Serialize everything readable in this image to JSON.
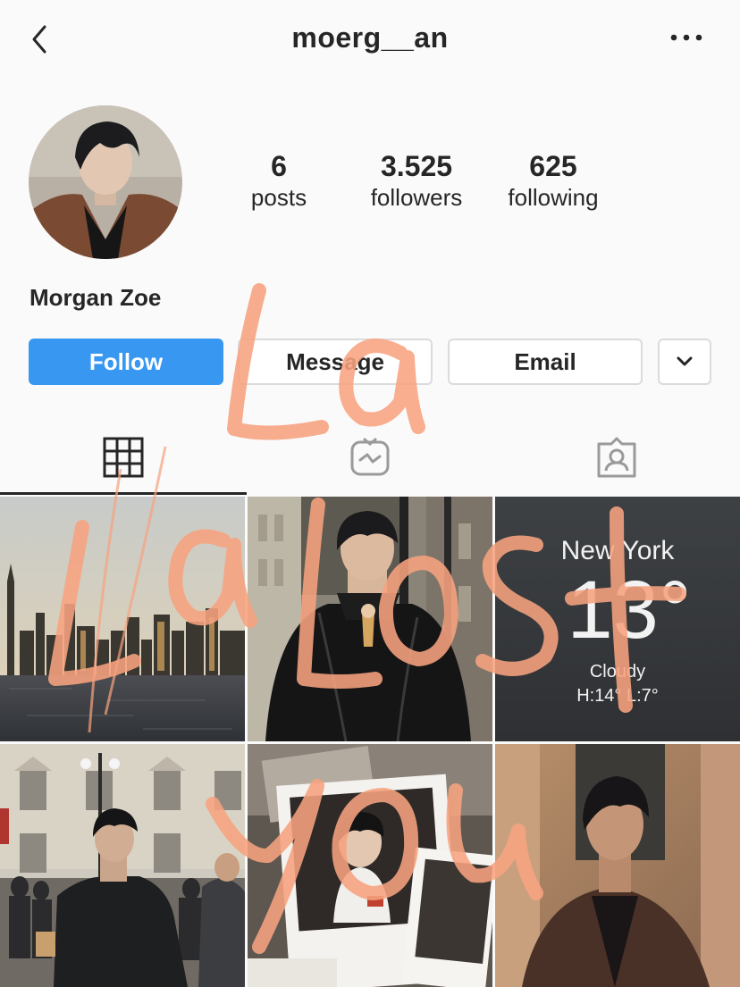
{
  "header": {
    "username": "moerg__an"
  },
  "profile": {
    "full_name": "Morgan Zoe",
    "stats": [
      {
        "value": "6",
        "label": "posts"
      },
      {
        "value": "3.525",
        "label": "followers"
      },
      {
        "value": "625",
        "label": "following"
      }
    ]
  },
  "actions": {
    "follow": "Follow",
    "message": "Message",
    "email": "Email"
  },
  "tabs": [
    {
      "icon": "grid-icon",
      "active": true
    },
    {
      "icon": "igtv-icon",
      "active": false
    },
    {
      "icon": "tagged-icon",
      "active": false
    }
  ],
  "posts": [
    {
      "subject": "city skyline over water"
    },
    {
      "subject": "man in black leather jacket"
    },
    {
      "subject": "weather widget",
      "city": "New York",
      "temp": "13°",
      "condition": "Cloudy",
      "hilo": "H:14° L:7°"
    },
    {
      "subject": "man in black jacket on street"
    },
    {
      "subject": "polaroid photos"
    },
    {
      "subject": "man in brown coat portrait"
    }
  ],
  "overlay": {
    "handwriting": [
      "La",
      "Lost",
      "you"
    ],
    "color": "#f7a37f"
  },
  "colors": {
    "follow_bg": "#3897f0",
    "text": "#262626",
    "border": "#dbdbdb"
  }
}
